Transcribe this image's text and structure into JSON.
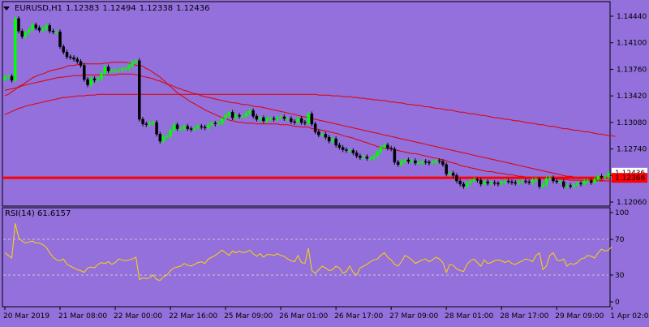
{
  "header": {
    "symbol": "EURUSD,H1",
    "open": "1.12383",
    "high": "1.12494",
    "low": "1.12338",
    "close": "1.12436"
  },
  "rsi_header": {
    "label": "RSI(14) 61.6157"
  },
  "colors": {
    "background": "#9370DB",
    "bull_candle": "#00FF00",
    "bear_candle": "#000000",
    "moving_average": "#DD0000",
    "hline": "#FF0000",
    "rsi_line": "#FFD700",
    "bid_label_bg": "#FF0000",
    "bid_label_text": "#FFFFFF",
    "ask_label_bg": "#FFFFFF"
  },
  "chart_data": [
    {
      "type": "candlestick",
      "ylim": [
        1.1995,
        1.146
      ],
      "y_ticks": [
        "1.14440",
        "1.14100",
        "1.13760",
        "1.13420",
        "1.13080",
        "1.12740",
        "1.12400",
        "1.12060"
      ],
      "y_tick_values": [
        1.1444,
        1.141,
        1.1376,
        1.1342,
        1.1308,
        1.1274,
        1.124,
        1.1206
      ],
      "x_labels": [
        "20 Mar 2019",
        "21 Mar 08:00",
        "22 Mar 00:00",
        "22 Mar 16:00",
        "25 Mar 09:00",
        "26 Mar 01:00",
        "26 Mar 17:00",
        "27 Mar 09:00",
        "28 Mar 01:00",
        "28 Mar 17:00",
        "29 Mar 09:00",
        "1 Apr 02:00"
      ],
      "x_label_index": [
        0,
        16,
        32,
        48,
        64,
        80,
        96,
        112,
        128,
        144,
        160,
        176
      ],
      "bid_label": "1.12366",
      "ask_label": "1.12436",
      "hline_value": 1.1237,
      "close_series": [
        1.1366,
        1.1367,
        1.1362,
        1.1441,
        1.1425,
        1.1418,
        1.1423,
        1.1427,
        1.1433,
        1.1429,
        1.1426,
        1.1428,
        1.1432,
        1.1425,
        1.1424,
        1.1424,
        1.1405,
        1.1398,
        1.1392,
        1.1391,
        1.1389,
        1.1386,
        1.1381,
        1.1363,
        1.1356,
        1.1364,
        1.1362,
        1.1364,
        1.1371,
        1.1379,
        1.1374,
        1.1374,
        1.1375,
        1.1375,
        1.1377,
        1.1377,
        1.1381,
        1.1385,
        1.1387,
        1.1312,
        1.1306,
        1.1305,
        1.1307,
        1.1308,
        1.1293,
        1.1284,
        1.129,
        1.129,
        1.1298,
        1.1305,
        1.13,
        1.13,
        1.1303,
        1.13,
        1.1299,
        1.1301,
        1.1303,
        1.1302,
        1.1301,
        1.1305,
        1.1307,
        1.1306,
        1.1307,
        1.1313,
        1.1317,
        1.1321,
        1.1314,
        1.1317,
        1.1316,
        1.1316,
        1.132,
        1.1323,
        1.1316,
        1.1312,
        1.1314,
        1.131,
        1.1313,
        1.1313,
        1.1312,
        1.1314,
        1.1315,
        1.1313,
        1.1313,
        1.1309,
        1.1308,
        1.1313,
        1.1308,
        1.1307,
        1.1319,
        1.1306,
        1.1296,
        1.1292,
        1.1293,
        1.1289,
        1.1284,
        1.1287,
        1.1279,
        1.1276,
        1.1273,
        1.1272,
        1.1272,
        1.1269,
        1.1265,
        1.1263,
        1.1264,
        1.1262,
        1.1262,
        1.1265,
        1.127,
        1.1276,
        1.1279,
        1.1275,
        1.1274,
        1.1257,
        1.1254,
        1.1258,
        1.126,
        1.1258,
        1.1259,
        1.1256,
        1.1256,
        1.1258,
        1.1257,
        1.1256,
        1.1257,
        1.1259,
        1.1258,
        1.1254,
        1.1242,
        1.1243,
        1.124,
        1.1233,
        1.1229,
        1.1226,
        1.123,
        1.1233,
        1.1235,
        1.1234,
        1.1229,
        1.1232,
        1.123,
        1.1231,
        1.123,
        1.1229,
        1.1231,
        1.1233,
        1.1232,
        1.1231,
        1.123,
        1.1232,
        1.1233,
        1.1232,
        1.1231,
        1.1234,
        1.1235,
        1.1226,
        1.1228,
        1.1236,
        1.1237,
        1.1233,
        1.1232,
        1.1232,
        1.1226,
        1.1227,
        1.1226,
        1.1228,
        1.123,
        1.1229,
        1.1233,
        1.1233,
        1.1231,
        1.1235,
        1.1239,
        1.1238,
        1.1238,
        1.1243
      ],
      "ma_fast": [
        1.1342,
        1.1344,
        1.1347,
        1.135,
        1.1354,
        1.1356,
        1.1359,
        1.1362,
        1.1365,
        1.1367,
        1.1369,
        1.137,
        1.1372,
        1.1374,
        1.1375,
        1.1376,
        1.1377,
        1.1378,
        1.138,
        1.1381,
        1.1381,
        1.1382,
        1.1383,
        1.1383,
        1.1383,
        1.1383,
        1.1383,
        1.1383,
        1.1383,
        1.1384,
        1.1384,
        1.1385,
        1.1385,
        1.1385,
        1.1385,
        1.1385,
        1.1384,
        1.1383,
        1.1381,
        1.1381,
        1.138,
        1.1377,
        1.1375,
        1.1372,
        1.1369,
        1.1366,
        1.1362,
        1.1358,
        1.1354,
        1.135,
        1.1346,
        1.1343,
        1.134,
        1.1337,
        1.1334,
        1.1332,
        1.1329,
        1.1327,
        1.1324,
        1.1322,
        1.132,
        1.1318,
        1.1316,
        1.1314,
        1.1313,
        1.1311,
        1.131,
        1.1309,
        1.1308,
        1.1308,
        1.1307,
        1.1307,
        1.1307,
        1.1306,
        1.1306,
        1.1306,
        1.1306,
        1.1306,
        1.1306,
        1.1306,
        1.1305,
        1.1305,
        1.1305,
        1.1304,
        1.1303,
        1.1303,
        1.1302,
        1.1302,
        1.1302,
        1.13,
        1.13,
        1.1299,
        1.1298,
        1.1297,
        1.1296,
        1.1295,
        1.1294,
        1.1293,
        1.1291,
        1.129,
        1.1289,
        1.1288,
        1.1286,
        1.1285,
        1.1283,
        1.1282,
        1.128,
        1.1279,
        1.1277,
        1.1276,
        1.1275,
        1.1275,
        1.1274,
        1.1273,
        1.1272,
        1.1271,
        1.127,
        1.1269,
        1.1268,
        1.1268,
        1.1267,
        1.1266,
        1.1265,
        1.1264,
        1.1263,
        1.1262,
        1.1261,
        1.126,
        1.1259,
        1.1257,
        1.1256,
        1.1255,
        1.1253,
        1.1252,
        1.1251,
        1.125,
        1.1249,
        1.1248,
        1.1247,
        1.1246,
        1.1245,
        1.1245,
        1.1244,
        1.1243,
        1.1243,
        1.1242,
        1.1241,
        1.1241,
        1.124,
        1.1239,
        1.1239,
        1.1238,
        1.1238,
        1.1237,
        1.1237,
        1.1237,
        1.1236,
        1.1236,
        1.1236,
        1.1236,
        1.1236,
        1.1235,
        1.1235,
        1.1235,
        1.1234,
        1.1234,
        1.1234,
        1.1234,
        1.1234,
        1.1234,
        1.1234,
        1.1233,
        1.1233,
        1.1233,
        1.1233,
        1.1233,
        1.1233
      ],
      "ma_mid": [
        1.1349,
        1.135,
        1.1351,
        1.1352,
        1.1353,
        1.1355,
        1.1356,
        1.1357,
        1.1358,
        1.1359,
        1.136,
        1.1361,
        1.1362,
        1.1363,
        1.1364,
        1.1365,
        1.1366,
        1.1366,
        1.1367,
        1.1367,
        1.1368,
        1.1368,
        1.1368,
        1.1369,
        1.1369,
        1.1369,
        1.1369,
        1.1369,
        1.1369,
        1.1369,
        1.1369,
        1.1369,
        1.1369,
        1.137,
        1.137,
        1.137,
        1.137,
        1.137,
        1.1369,
        1.1368,
        1.1367,
        1.1366,
        1.1365,
        1.1364,
        1.1362,
        1.1361,
        1.1359,
        1.1357,
        1.1356,
        1.1354,
        1.1352,
        1.1351,
        1.1349,
        1.1348,
        1.1346,
        1.1345,
        1.1344,
        1.1342,
        1.1341,
        1.134,
        1.1339,
        1.1338,
        1.1337,
        1.1336,
        1.1335,
        1.1334,
        1.1333,
        1.1333,
        1.1332,
        1.1331,
        1.1331,
        1.133,
        1.1329,
        1.1328,
        1.1328,
        1.1327,
        1.1326,
        1.1325,
        1.1324,
        1.1323,
        1.1322,
        1.1321,
        1.132,
        1.1319,
        1.1318,
        1.1317,
        1.1316,
        1.1315,
        1.1314,
        1.1313,
        1.1312,
        1.1311,
        1.131,
        1.1309,
        1.1308,
        1.1307,
        1.1306,
        1.1305,
        1.1304,
        1.1303,
        1.1302,
        1.1301,
        1.13,
        1.1299,
        1.1298,
        1.1297,
        1.1296,
        1.1295,
        1.1294,
        1.1293,
        1.1292,
        1.1291,
        1.129,
        1.1289,
        1.1288,
        1.1287,
        1.1286,
        1.1285,
        1.1284,
        1.1283,
        1.1282,
        1.1281,
        1.128,
        1.1279,
        1.1278,
        1.1277,
        1.1276,
        1.1275,
        1.1274,
        1.1273,
        1.1272,
        1.1271,
        1.127,
        1.1269,
        1.1268,
        1.1267,
        1.1266,
        1.1265,
        1.1264,
        1.1263,
        1.1262,
        1.1261,
        1.126,
        1.1259,
        1.1258,
        1.1257,
        1.1256,
        1.1255,
        1.1254,
        1.1253,
        1.1252,
        1.1251,
        1.125,
        1.1249,
        1.1248,
        1.1247,
        1.1246,
        1.1245,
        1.1244,
        1.1243,
        1.1242,
        1.1241,
        1.124,
        1.1239,
        1.1239,
        1.1238,
        1.1237,
        1.1237,
        1.1236,
        1.1236,
        1.1235,
        1.1235,
        1.1234,
        1.1234,
        1.1233,
        1.1233,
        1.1233
      ],
      "ma_slow": [
        1.1318,
        1.132,
        1.1322,
        1.1324,
        1.1326,
        1.1327,
        1.1329,
        1.133,
        1.1331,
        1.1332,
        1.1333,
        1.1334,
        1.1335,
        1.1336,
        1.1337,
        1.1338,
        1.1339,
        1.134,
        1.134,
        1.1341,
        1.1341,
        1.1342,
        1.1342,
        1.1342,
        1.1343,
        1.1343,
        1.1343,
        1.1344,
        1.1344,
        1.1344,
        1.1344,
        1.1344,
        1.1344,
        1.1344,
        1.1344,
        1.1344,
        1.1344,
        1.1344,
        1.1344,
        1.1344,
        1.1344,
        1.1344,
        1.1344,
        1.1344,
        1.1344,
        1.1344,
        1.1344,
        1.1344,
        1.1344,
        1.1344,
        1.1344,
        1.1344,
        1.1344,
        1.1344,
        1.1344,
        1.1344,
        1.1344,
        1.1344,
        1.1344,
        1.1344,
        1.1344,
        1.1344,
        1.1344,
        1.1344,
        1.1344,
        1.1344,
        1.1344,
        1.1344,
        1.1344,
        1.1344,
        1.1344,
        1.1344,
        1.1344,
        1.1344,
        1.1344,
        1.1344,
        1.1344,
        1.1344,
        1.1344,
        1.1344,
        1.1344,
        1.1344,
        1.1344,
        1.1344,
        1.1344,
        1.1344,
        1.1344,
        1.1344,
        1.1344,
        1.1344,
        1.1344,
        1.1343,
        1.1343,
        1.1343,
        1.1343,
        1.1342,
        1.1342,
        1.1342,
        1.1341,
        1.1341,
        1.1341,
        1.134,
        1.134,
        1.1339,
        1.1339,
        1.1338,
        1.1338,
        1.1337,
        1.1337,
        1.1336,
        1.1336,
        1.1335,
        1.1334,
        1.1334,
        1.1333,
        1.1333,
        1.1332,
        1.1331,
        1.1331,
        1.133,
        1.133,
        1.1329,
        1.1328,
        1.1328,
        1.1327,
        1.1326,
        1.1326,
        1.1325,
        1.1324,
        1.1324,
        1.1323,
        1.1322,
        1.1321,
        1.1321,
        1.132,
        1.1319,
        1.1319,
        1.1318,
        1.1317,
        1.1317,
        1.1316,
        1.1315,
        1.1314,
        1.1314,
        1.1313,
        1.1312,
        1.1312,
        1.1311,
        1.131,
        1.131,
        1.1309,
        1.1308,
        1.1307,
        1.1307,
        1.1306,
        1.1305,
        1.1305,
        1.1304,
        1.1303,
        1.1303,
        1.1302,
        1.1301,
        1.13,
        1.13,
        1.1299,
        1.1298,
        1.1298,
        1.1297,
        1.1296,
        1.1296,
        1.1295,
        1.1294,
        1.1293,
        1.1293,
        1.1292,
        1.1291,
        1.1291,
        1.129
      ]
    },
    {
      "type": "line",
      "ylim": [
        0,
        100
      ],
      "y_ticks": [
        "100",
        "70",
        "30",
        "0"
      ],
      "y_tick_values": [
        100,
        70,
        30,
        0
      ],
      "levels": [
        70,
        30
      ],
      "rsi_values": [
        55,
        52,
        49,
        88,
        72,
        68,
        66,
        67,
        68,
        66,
        66,
        64,
        61,
        55,
        50,
        47,
        46,
        48,
        42,
        40,
        38,
        36,
        35,
        33,
        38,
        39,
        38,
        42,
        44,
        43,
        45,
        42,
        44,
        48,
        47,
        46,
        47,
        48,
        50,
        25,
        27,
        26,
        27,
        30,
        25,
        24,
        28,
        30,
        35,
        38,
        39,
        40,
        43,
        41,
        40,
        42,
        44,
        45,
        43,
        48,
        50,
        52,
        55,
        58,
        55,
        52,
        57,
        55,
        57,
        55,
        56,
        58,
        54,
        51,
        54,
        50,
        53,
        53,
        52,
        54,
        52,
        51,
        48,
        46,
        45,
        52,
        44,
        43,
        60,
        35,
        32,
        36,
        40,
        38,
        35,
        36,
        40,
        38,
        32,
        34,
        40,
        33,
        30,
        38,
        40,
        42,
        45,
        47,
        48,
        52,
        55,
        50,
        47,
        42,
        40,
        45,
        52,
        50,
        47,
        43,
        45,
        47,
        48,
        45,
        47,
        50,
        48,
        44,
        33,
        42,
        41,
        37,
        35,
        34,
        42,
        46,
        48,
        44,
        40,
        47,
        43,
        44,
        46,
        47,
        46,
        44,
        46,
        43,
        42,
        44,
        46,
        48,
        47,
        45,
        52,
        55,
        36,
        40,
        52,
        55,
        47,
        46,
        48,
        40,
        43,
        42,
        44,
        48,
        49,
        52,
        51,
        49,
        55,
        59,
        57,
        58,
        62
      ]
    }
  ]
}
